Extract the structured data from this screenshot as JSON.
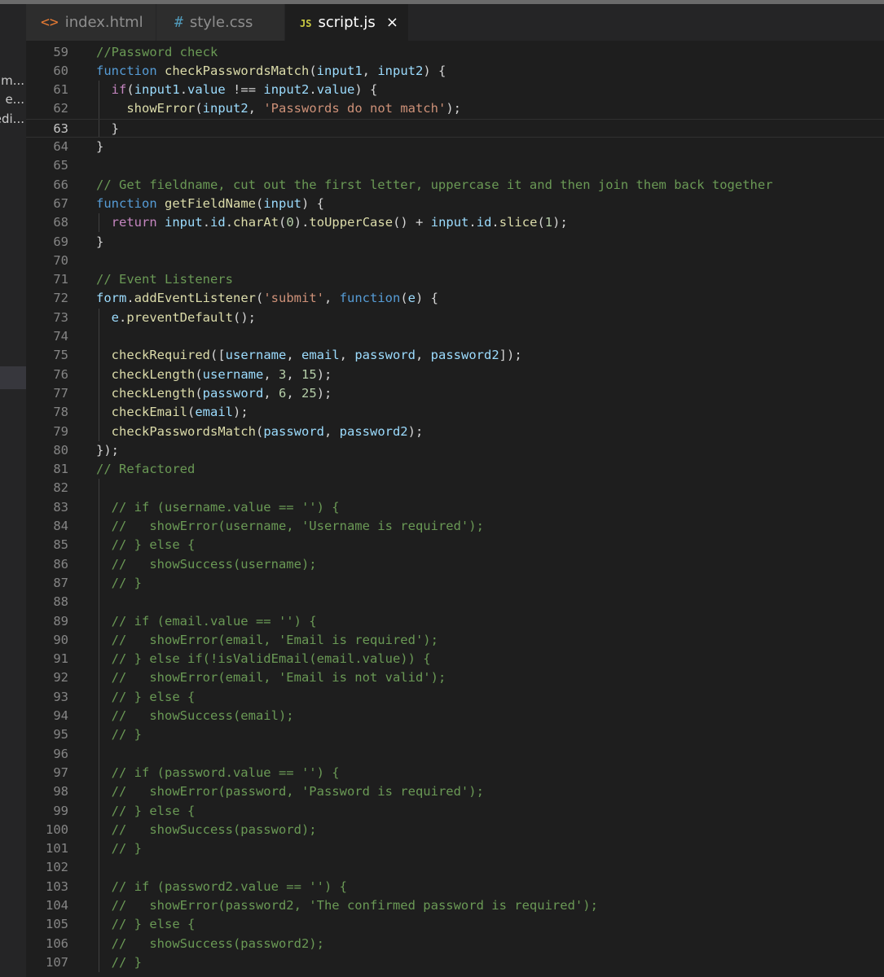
{
  "sidebar": {
    "items": [
      {
        "label": "m..."
      },
      {
        "label": "e..."
      },
      {
        "label": "edi..."
      }
    ]
  },
  "tabs": [
    {
      "icon": "<>",
      "label": "index.html"
    },
    {
      "icon": "#",
      "label": "style.css"
    },
    {
      "icon": "JS",
      "label": "script.js",
      "close": "×"
    }
  ],
  "editor": {
    "current_line": 63,
    "lines": [
      {
        "n": 59,
        "text": "//Password check"
      },
      {
        "n": 60,
        "text": "function checkPasswordsMatch(input1, input2) {"
      },
      {
        "n": 61,
        "text": "  if(input1.value !== input2.value) {"
      },
      {
        "n": 62,
        "text": "    showError(input2, 'Passwords do not match');"
      },
      {
        "n": 63,
        "text": "  }"
      },
      {
        "n": 64,
        "text": "}"
      },
      {
        "n": 65,
        "text": ""
      },
      {
        "n": 66,
        "text": "// Get fieldname, cut out the first letter, uppercase it and then join them back together"
      },
      {
        "n": 67,
        "text": "function getFieldName(input) {"
      },
      {
        "n": 68,
        "text": "  return input.id.charAt(0).toUpperCase() + input.id.slice(1);"
      },
      {
        "n": 69,
        "text": "}"
      },
      {
        "n": 70,
        "text": ""
      },
      {
        "n": 71,
        "text": "// Event Listeners"
      },
      {
        "n": 72,
        "text": "form.addEventListener('submit', function(e) {"
      },
      {
        "n": 73,
        "text": "  e.preventDefault();"
      },
      {
        "n": 74,
        "text": ""
      },
      {
        "n": 75,
        "text": "  checkRequired([username, email, password, password2]);"
      },
      {
        "n": 76,
        "text": "  checkLength(username, 3, 15);"
      },
      {
        "n": 77,
        "text": "  checkLength(password, 6, 25);"
      },
      {
        "n": 78,
        "text": "  checkEmail(email);"
      },
      {
        "n": 79,
        "text": "  checkPasswordsMatch(password, password2);"
      },
      {
        "n": 80,
        "text": "});"
      },
      {
        "n": 81,
        "text": "// Refactored"
      },
      {
        "n": 82,
        "text": ""
      },
      {
        "n": 83,
        "text": "  // if (username.value == '') {"
      },
      {
        "n": 84,
        "text": "  //   showError(username, 'Username is required');"
      },
      {
        "n": 85,
        "text": "  // } else {"
      },
      {
        "n": 86,
        "text": "  //   showSuccess(username);"
      },
      {
        "n": 87,
        "text": "  // }"
      },
      {
        "n": 88,
        "text": ""
      },
      {
        "n": 89,
        "text": "  // if (email.value == '') {"
      },
      {
        "n": 90,
        "text": "  //   showError(email, 'Email is required');"
      },
      {
        "n": 91,
        "text": "  // } else if(!isValidEmail(email.value)) {"
      },
      {
        "n": 92,
        "text": "  //   showError(email, 'Email is not valid');"
      },
      {
        "n": 93,
        "text": "  // } else {"
      },
      {
        "n": 94,
        "text": "  //   showSuccess(email);"
      },
      {
        "n": 95,
        "text": "  // }"
      },
      {
        "n": 96,
        "text": ""
      },
      {
        "n": 97,
        "text": "  // if (password.value == '') {"
      },
      {
        "n": 98,
        "text": "  //   showError(password, 'Password is required');"
      },
      {
        "n": 99,
        "text": "  // } else {"
      },
      {
        "n": 100,
        "text": "  //   showSuccess(password);"
      },
      {
        "n": 101,
        "text": "  // }"
      },
      {
        "n": 102,
        "text": ""
      },
      {
        "n": 103,
        "text": "  // if (password2.value == '') {"
      },
      {
        "n": 104,
        "text": "  //   showError(password2, 'The confirmed password is required');"
      },
      {
        "n": 105,
        "text": "  // } else {"
      },
      {
        "n": 106,
        "text": "  //   showSuccess(password2);"
      },
      {
        "n": 107,
        "text": "  // }"
      }
    ]
  }
}
